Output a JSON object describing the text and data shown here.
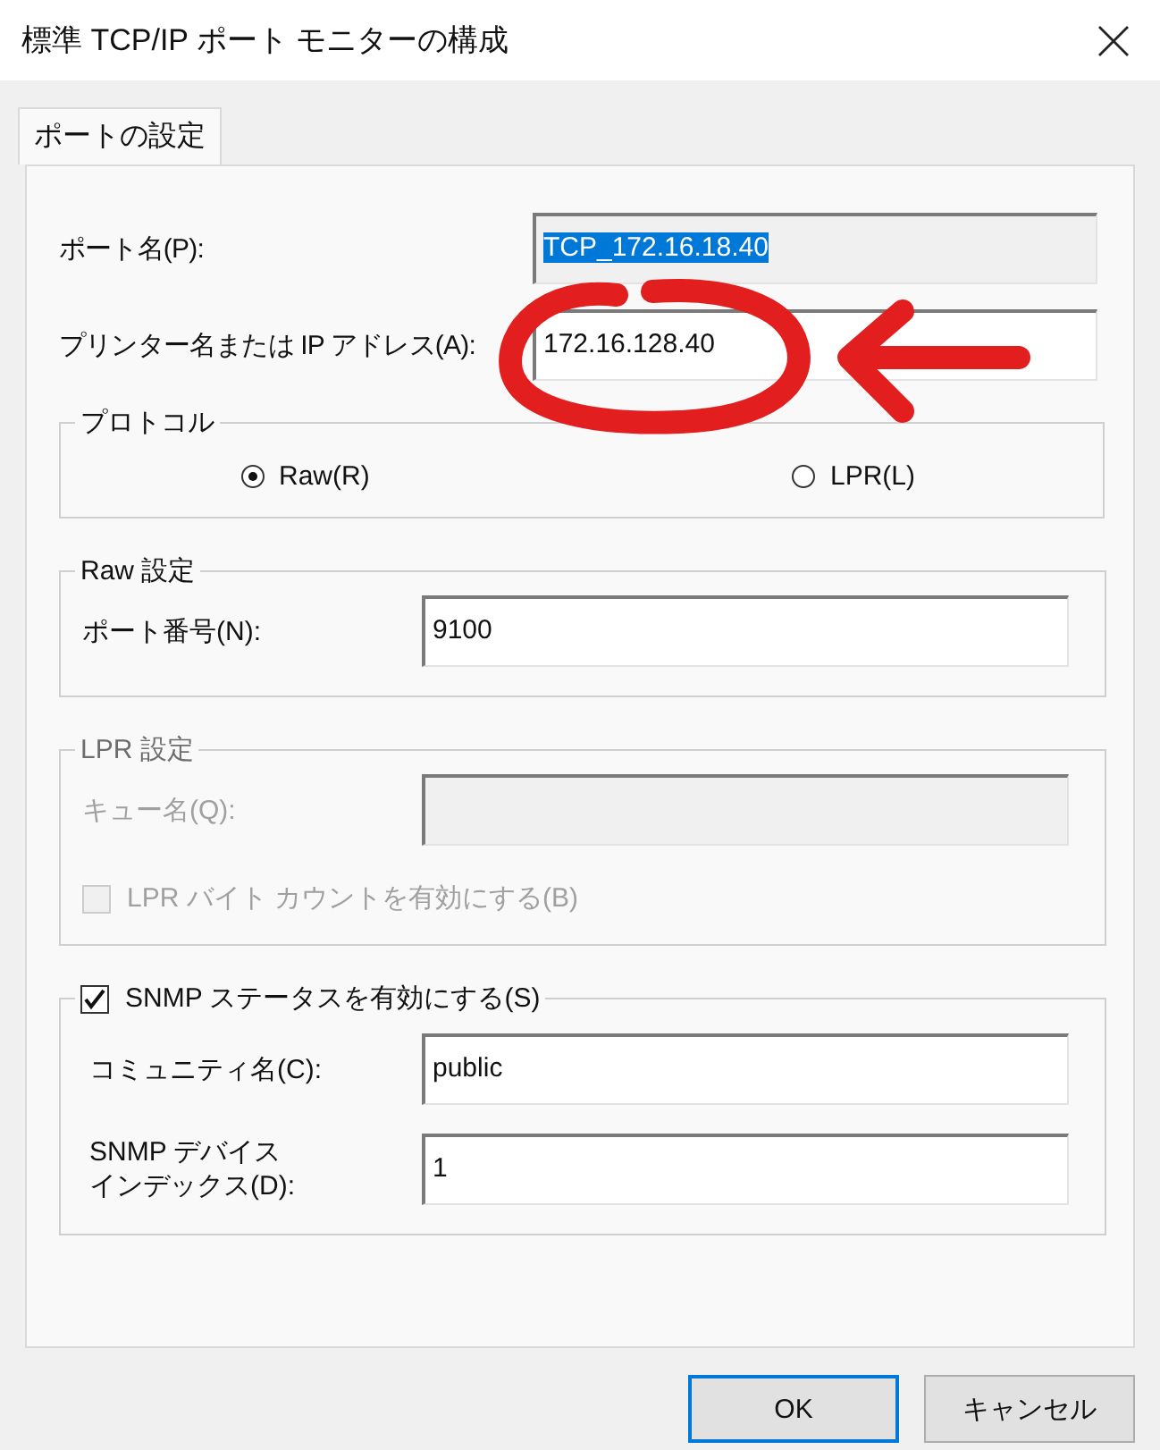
{
  "window": {
    "title": "標準 TCP/IP ポート モニターの構成"
  },
  "tabs": [
    {
      "label": "ポートの設定",
      "selected": true
    }
  ],
  "port_name": {
    "label": "ポート名(P):",
    "value": "TCP_172.16.18.40",
    "read_only": true,
    "highlighted": true
  },
  "printer_address": {
    "label": "プリンター名または IP アドレス(A):",
    "value": "172.16.128.40",
    "read_only": false,
    "highlighted": false
  },
  "protocol": {
    "title": "プロトコル",
    "options": [
      {
        "label": "Raw(R)",
        "selected": true
      },
      {
        "label": "LPR(L)",
        "selected": false
      }
    ]
  },
  "raw_settings": {
    "title": "Raw 設定",
    "port_number": {
      "label": "ポート番号(N):",
      "value": "9100"
    }
  },
  "lpr_settings": {
    "title": "LPR 設定",
    "disabled": true,
    "queue_name": {
      "label": "キュー名(Q):"
    },
    "byte_count": {
      "label": "LPR バイト カウントを有効にする(B)",
      "checked": false
    }
  },
  "snmp": {
    "label": "SNMP ステータスを有効にする(S)",
    "checked": true,
    "fields": [
      {
        "label": "コミュニティ名(C):",
        "value": "public"
      },
      {
        "label_lines": [
          "SNMP デバイス",
          "インデックス(D):"
        ],
        "value": "1"
      }
    ]
  },
  "buttons": [
    {
      "label": "OK",
      "default": true
    },
    {
      "label": "キャンセル",
      "default": false
    }
  ],
  "annotations": {
    "circle": {
      "color": "#e31e1e"
    },
    "arrow": {
      "color": "#e31e1e"
    }
  }
}
